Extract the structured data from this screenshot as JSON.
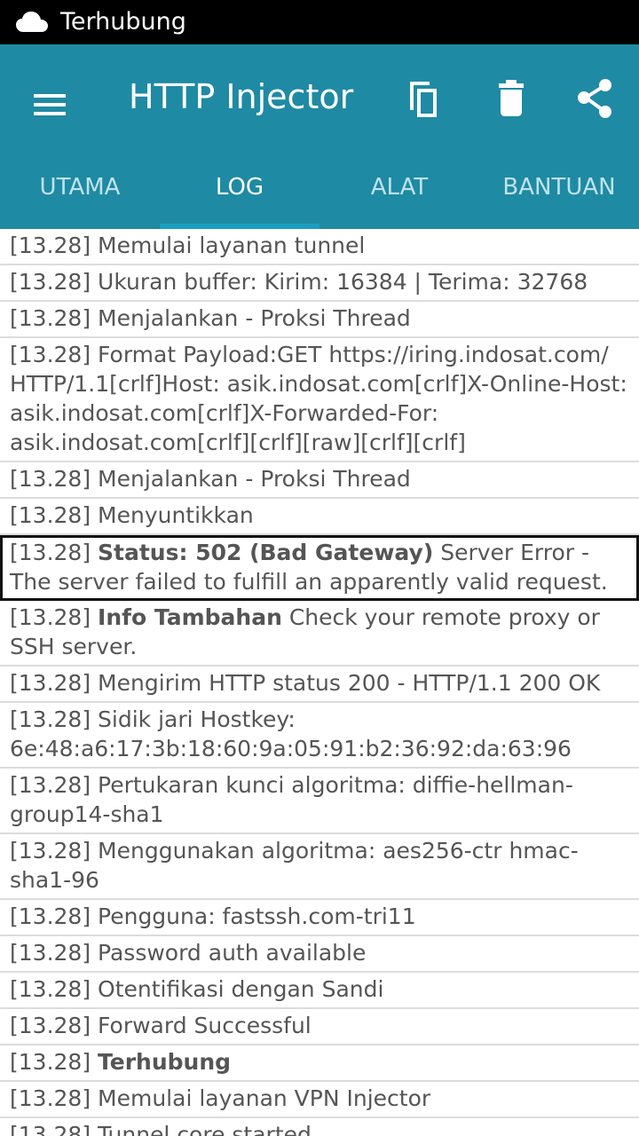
{
  "status_bar": {
    "icon": "cloud-icon",
    "text": "Terhubung"
  },
  "appbar": {
    "title": "HTTP Injector",
    "menu_icon": "hamburger-menu-icon",
    "actions": [
      "copy-icon",
      "delete-icon",
      "share-icon"
    ],
    "color": "#1f8aa3"
  },
  "tabs": [
    {
      "label": "UTAMA",
      "active": false
    },
    {
      "label": "LOG",
      "active": true
    },
    {
      "label": "ALAT",
      "active": false
    },
    {
      "label": "BANTUAN",
      "active": false
    }
  ],
  "log": [
    {
      "time": "[13.28]",
      "bold": "",
      "text": "Memulai layanan tunnel"
    },
    {
      "time": "[13.28]",
      "bold": "",
      "text": "Ukuran buffer: Kirim: 16384 | Terima: 32768"
    },
    {
      "time": "[13.28]",
      "bold": "",
      "text": "Menjalankan - Proksi Thread"
    },
    {
      "time": "[13.28]",
      "bold": "",
      "text": "Format Payload:GET https://iring.indosat.com/ HTTP/1.1[crlf]Host: asik.indosat.com[crlf]X-Online-Host: asik.indosat.com[crlf]X-Forwarded-For: asik.indosat.com[crlf][crlf][raw][crlf][crlf]"
    },
    {
      "time": "[13.28]",
      "bold": "",
      "text": "Menjalankan - Proksi Thread"
    },
    {
      "time": "[13.28]",
      "bold": "",
      "text": "Menyuntikkan"
    },
    {
      "time": "[13.28]",
      "bold": "Status: 502 (Bad Gateway)",
      "text": "Server Error - The server failed to fulfill an apparently valid request.",
      "selected": true
    },
    {
      "time": "[13.28]",
      "bold": "Info Tambahan",
      "text": "Check your remote proxy or SSH server."
    },
    {
      "time": "[13.28]",
      "bold": "",
      "text": "Mengirim HTTP status 200 - HTTP/1.1 200 OK"
    },
    {
      "time": "[13.28]",
      "bold": "",
      "text": "Sidik jari Hostkey: 6e:48:a6:17:3b:18:60:9a:05:91:b2:36:92:da:63:96"
    },
    {
      "time": "[13.28]",
      "bold": "",
      "text": "Pertukaran kunci algoritma: diffie-hellman-group14-sha1"
    },
    {
      "time": "[13.28]",
      "bold": "",
      "text": "Menggunakan algoritma: aes256-ctr hmac-sha1-96"
    },
    {
      "time": "[13.28]",
      "bold": "",
      "text": "Pengguna: fastssh.com-tri11"
    },
    {
      "time": "[13.28]",
      "bold": "",
      "text": "Password auth available"
    },
    {
      "time": "[13.28]",
      "bold": "",
      "text": "Otentifikasi dengan Sandi"
    },
    {
      "time": "[13.28]",
      "bold": "",
      "text": "Forward Successful"
    },
    {
      "time": "[13.28]",
      "bold": "Terhubung",
      "text": ""
    },
    {
      "time": "[13.28]",
      "bold": "",
      "text": "Memulai layanan VPN Injector"
    },
    {
      "time": "[13.28]",
      "bold": "",
      "text": "Tunnel core started"
    }
  ]
}
